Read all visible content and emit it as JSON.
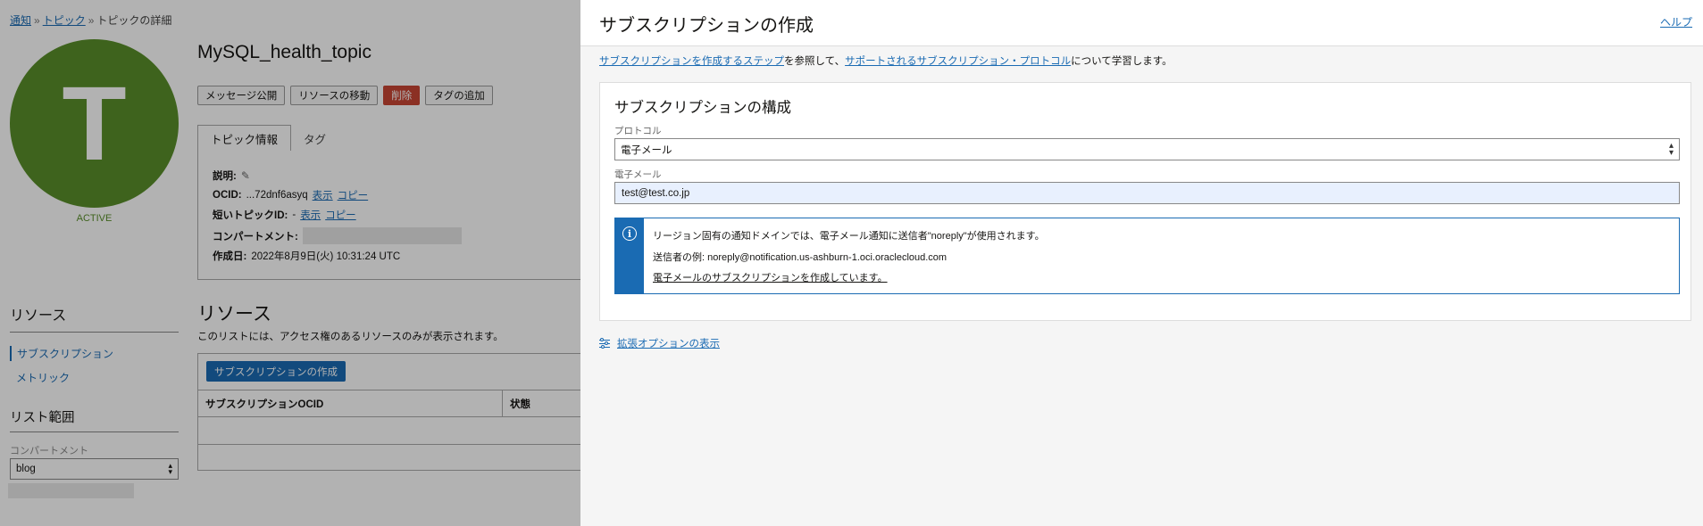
{
  "breadcrumb": {
    "items": [
      "通知",
      "トピック",
      "トピックの詳細"
    ],
    "sep": "»"
  },
  "topic": {
    "avatar_letter": "T",
    "status": "ACTIVE",
    "name": "MySQL_health_topic"
  },
  "actions": {
    "publish": "メッセージ公開",
    "move": "リソースの移動",
    "delete": "削除",
    "add_tags": "タグの追加"
  },
  "tabs": {
    "info": "トピック情報",
    "tags": "タグ"
  },
  "topic_info": {
    "description_label": "説明:",
    "ocid_label": "OCID:",
    "ocid_value": "...72dnf6asyq",
    "show": "表示",
    "copy": "コピー",
    "short_id_label": "短いトピックID:",
    "short_id_value": "-",
    "compartment_label": "コンパートメント:",
    "created_label": "作成日:",
    "created_value": "2022年8月9日(火) 10:31:24 UTC"
  },
  "sidebar": {
    "resources_heading": "リソース",
    "items": [
      "サブスクリプション",
      "メトリック"
    ],
    "scope_heading": "リスト範囲",
    "compartment_label": "コンパートメント",
    "compartment_value": "blog"
  },
  "resources": {
    "heading": "リソース",
    "description": "このリストには、アクセス権のあるリソースのみが表示されます。",
    "create_button": "サブスクリプションの作成",
    "columns": [
      "サブスクリプションOCID",
      "状態"
    ]
  },
  "drawer": {
    "title": "サブスクリプションの作成",
    "help": "ヘルプ",
    "intro_link1": "サブスクリプションを作成するステップ",
    "intro_text1": "を参照して、",
    "intro_link2": "サポートされるサブスクリプション・プロトコル",
    "intro_text2": "について学習します。",
    "card_title": "サブスクリプションの構成",
    "protocol_label": "プロトコル",
    "protocol_value": "電子メール",
    "email_label": "電子メール",
    "email_value": "test@test.co.jp",
    "info_line1": "リージョン固有の通知ドメインでは、電子メール通知に送信者\"noreply\"が使用されます。",
    "info_line2": "送信者の例: noreply@notification.us-ashburn-1.oci.oraclecloud.com",
    "info_link": "電子メールのサブスクリプションを作成しています。",
    "advanced": "拡張オプションの表示"
  }
}
